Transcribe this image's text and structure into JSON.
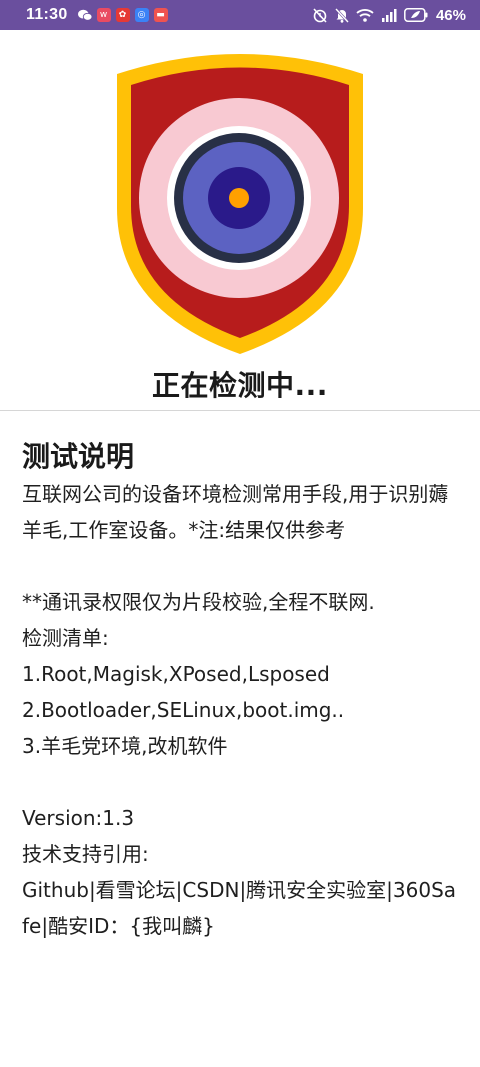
{
  "status_bar": {
    "time": "11:30",
    "battery_percent": "46%",
    "background_color": "#6a4f9e",
    "app_icons": [
      "wechat-icon",
      "weibo-icon",
      "paw-app-icon",
      "browser-icon",
      "news-icon"
    ],
    "right_icons": [
      "alarm-off-icon",
      "mute-icon",
      "wifi-icon",
      "signal-icon",
      "battery-icon"
    ]
  },
  "shield": {
    "colors": {
      "outer": "#ffc107",
      "fill": "#b71c1c",
      "ring_pink": "#f8c9d2",
      "ring_white": "#ffffff",
      "ring_dark": "#283046",
      "ring_blue": "#5c62c2",
      "ring_navy": "#2a1a8a",
      "center": "#ffa000"
    }
  },
  "status_text": "正在检测中...",
  "section": {
    "title": "测试说明",
    "body": "互联网公司的设备环境检测常用手段,用于识别薅羊毛,工作室设备。*注:结果仅供参考\n\n**通讯录权限仅为片段校验,全程不联网.\n检测清单:\n1.Root,Magisk,XPosed,Lsposed\n2.Bootloader,SELinux,boot.img..\n3.羊毛党环境,改机软件\n\nVersion:1.3\n技术支持引用:\nGithub|看雪论坛|CSDN|腾讯安全实验室|360Safe|酷安ID：{我叫麟}"
  }
}
